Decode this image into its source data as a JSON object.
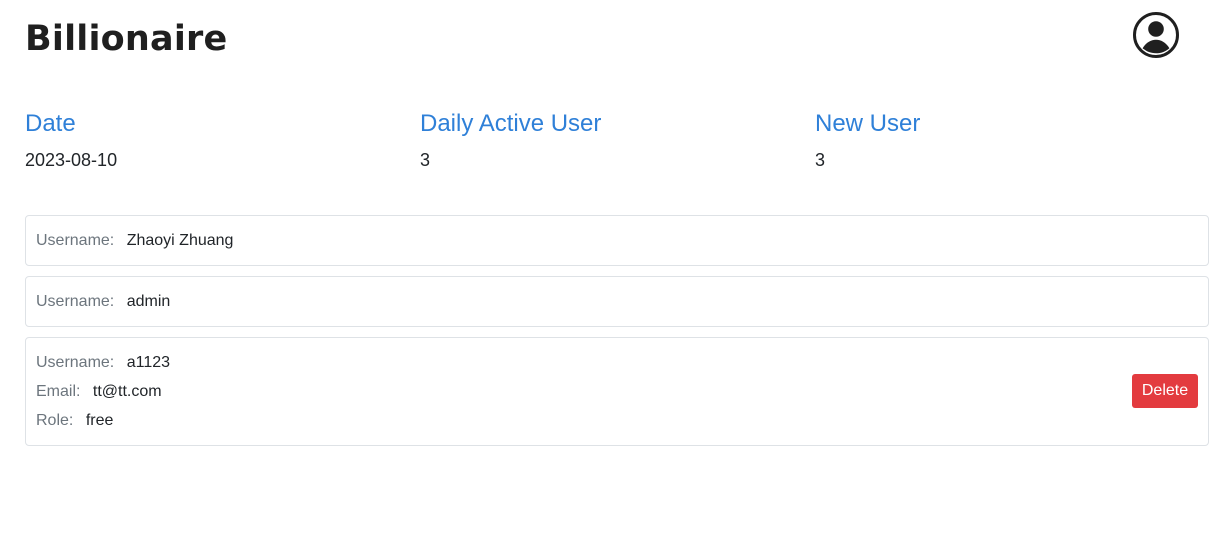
{
  "app": {
    "title": "Billionaire"
  },
  "header": {
    "avatar_icon": "user-circle-icon"
  },
  "stats": {
    "date": {
      "label": "Date",
      "value": "2023-08-10"
    },
    "dau": {
      "label": "Daily Active User",
      "value": "3"
    },
    "new_user": {
      "label": "New User",
      "value": "3"
    }
  },
  "users": [
    {
      "username_label": "Username:",
      "username": "Zhaoyi Zhuang"
    },
    {
      "username_label": "Username:",
      "username": "admin"
    },
    {
      "username_label": "Username:",
      "username": "a1123",
      "email_label": "Email:",
      "email": "tt@tt.com",
      "role_label": "Role:",
      "role": "free",
      "delete_label": "Delete"
    }
  ],
  "colors": {
    "accent": "#2f80d8",
    "danger": "#e33b3f",
    "border": "#dee2e6",
    "muted_text": "#6c757d"
  }
}
